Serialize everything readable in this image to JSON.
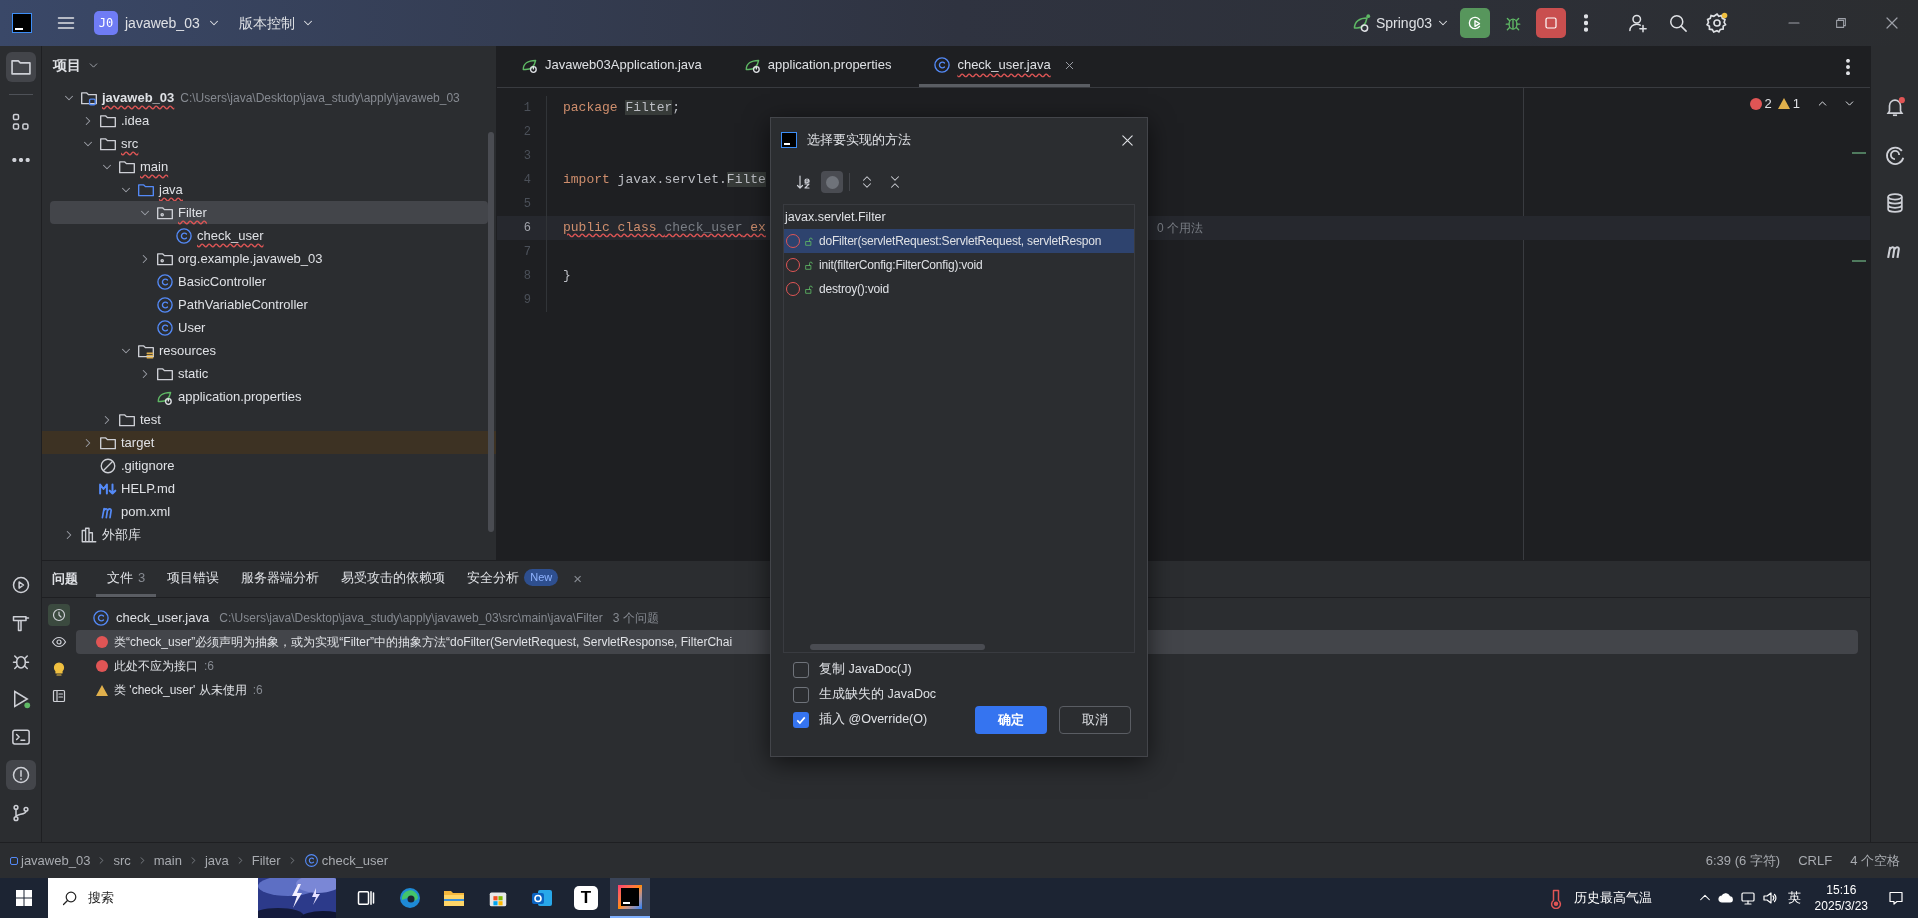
{
  "title_bar": {
    "project_badge": "J0",
    "project": "javaweb_03",
    "vcs": "版本控制",
    "run_config": "Spring03"
  },
  "left_toolbar": {
    "top": [
      {
        "kind": "project",
        "selected": true
      },
      {
        "kind": "structure",
        "selected": false
      },
      {
        "kind": "more",
        "selected": false
      }
    ],
    "bottom": [
      {
        "kind": "services",
        "selected": false
      },
      {
        "kind": "build",
        "selected": false
      },
      {
        "kind": "debug",
        "selected": false
      },
      {
        "kind": "run",
        "selected": false
      },
      {
        "kind": "terminal",
        "selected": false
      },
      {
        "kind": "problems",
        "selected": true
      },
      {
        "kind": "git",
        "selected": false
      }
    ]
  },
  "right_toolbar": [
    {
      "kind": "notifications",
      "badge": true
    },
    {
      "kind": "ai",
      "badge": false
    },
    {
      "kind": "database",
      "badge": false
    },
    {
      "kind": "maven",
      "badge": false
    }
  ],
  "project_panel": {
    "title": "项目",
    "tree": [
      {
        "label": "javaweb_03",
        "kind": "module",
        "hint": "C:\\Users\\java\\Desktop\\java_study\\apply\\javaweb_03",
        "expanded": true,
        "selected": false,
        "excluded": false,
        "has_error": true,
        "children": [
          {
            "label": ".idea",
            "kind": "folder",
            "expanded": false,
            "selected": false,
            "excluded": false,
            "has_error": false
          },
          {
            "label": "src",
            "kind": "folder",
            "expanded": true,
            "selected": false,
            "excluded": false,
            "has_error": true,
            "children": [
              {
                "label": "main",
                "kind": "folder",
                "expanded": true,
                "selected": false,
                "excluded": false,
                "has_error": true,
                "children": [
                  {
                    "label": "java",
                    "kind": "source",
                    "expanded": true,
                    "selected": false,
                    "excluded": false,
                    "has_error": true,
                    "children": [
                      {
                        "label": "Filter",
                        "kind": "package",
                        "expanded": true,
                        "selected": true,
                        "excluded": false,
                        "has_error": true,
                        "children": [
                          {
                            "label": "check_user",
                            "kind": "class",
                            "selected": false,
                            "excluded": false,
                            "has_error": true
                          }
                        ]
                      },
                      {
                        "label": "org.example.javaweb_03",
                        "kind": "package",
                        "expanded": false,
                        "selected": false,
                        "excluded": false,
                        "has_error": false
                      },
                      {
                        "label": "BasicController",
                        "kind": "class",
                        "selected": false,
                        "excluded": false,
                        "has_error": false
                      },
                      {
                        "label": "PathVariableController",
                        "kind": "class",
                        "selected": false,
                        "excluded": false,
                        "has_error": false
                      },
                      {
                        "label": "User",
                        "kind": "class",
                        "selected": false,
                        "excluded": false,
                        "has_error": false
                      }
                    ]
                  },
                  {
                    "label": "resources",
                    "kind": "resources",
                    "expanded": true,
                    "selected": false,
                    "excluded": false,
                    "has_error": false,
                    "children": [
                      {
                        "label": "static",
                        "kind": "folder",
                        "expanded": false,
                        "selected": false,
                        "excluded": false,
                        "has_error": false
                      },
                      {
                        "label": "application.properties",
                        "kind": "spring",
                        "selected": false,
                        "excluded": false,
                        "has_error": false
                      }
                    ]
                  }
                ]
              },
              {
                "label": "test",
                "kind": "folder",
                "expanded": false,
                "selected": false,
                "excluded": false,
                "has_error": false
              }
            ]
          },
          {
            "label": "target",
            "kind": "folder",
            "expanded": false,
            "selected": false,
            "excluded": true,
            "has_error": false
          },
          {
            "label": ".gitignore",
            "kind": "ignore",
            "selected": false,
            "excluded": false,
            "has_error": false
          },
          {
            "label": "HELP.md",
            "kind": "markdown",
            "selected": false,
            "excluded": false,
            "has_error": false
          },
          {
            "label": "pom.xml",
            "kind": "maven",
            "selected": false,
            "excluded": false,
            "has_error": false
          }
        ]
      },
      {
        "label": "外部库",
        "kind": "library",
        "expanded": false,
        "selected": false,
        "excluded": false,
        "has_error": false
      }
    ]
  },
  "editor": {
    "tabs": [
      {
        "label": "Javaweb03Application.java",
        "kind": "spring",
        "selected": false,
        "has_error": false
      },
      {
        "label": "application.properties",
        "kind": "spring",
        "selected": false,
        "has_error": false
      },
      {
        "label": "check_user.java",
        "kind": "class",
        "selected": true,
        "has_error": true
      }
    ],
    "errors": "2",
    "warnings": "1",
    "lines": [
      {
        "number": "1",
        "current": false,
        "tokens": [
          {
            "text": "package ",
            "kind": "keyword"
          },
          {
            "text": "Filter",
            "kind": "highlight"
          },
          {
            "text": ";",
            "kind": "plain"
          }
        ]
      },
      {
        "number": "2",
        "current": false
      },
      {
        "number": "3",
        "current": false
      },
      {
        "number": "4",
        "current": false,
        "tokens": [
          {
            "text": "import ",
            "kind": "keyword"
          },
          {
            "text": "javax.servlet.",
            "kind": "plain"
          },
          {
            "text": "Filte",
            "kind": "highlight"
          }
        ]
      },
      {
        "number": "5",
        "current": false
      },
      {
        "number": "6",
        "current": true,
        "inlay": "0 个用法",
        "tokens": [
          {
            "text": "public class ",
            "kind": "keyword_error"
          },
          {
            "text": "check_user",
            "kind": "unused_error"
          },
          {
            "text": " ex",
            "kind": "keyword_error"
          }
        ]
      },
      {
        "number": "7",
        "current": false
      },
      {
        "number": "8",
        "current": false,
        "tokens": [
          {
            "text": "}",
            "kind": "plain"
          }
        ]
      },
      {
        "number": "9",
        "current": false
      }
    ]
  },
  "problems_panel": {
    "title": "问题",
    "tabs": [
      {
        "label": "文件",
        "count": "3",
        "selected": true
      },
      {
        "label": "项目错误",
        "selected": false
      },
      {
        "label": "服务器端分析",
        "selected": false
      },
      {
        "label": "易受攻击的依赖项",
        "selected": false
      },
      {
        "label": "安全分析",
        "badge": "New",
        "selected": false
      }
    ],
    "close": "×",
    "toolbar": [
      {
        "kind": "autoscroll",
        "selected": true
      },
      {
        "kind": "preview",
        "selected": false
      },
      {
        "kind": "quickfix",
        "selected": false
      },
      {
        "kind": "details",
        "selected": false
      }
    ],
    "file": {
      "name": "check_user.java",
      "path": "C:\\Users\\java\\Desktop\\java_study\\apply\\javaweb_03\\src\\main\\java\\Filter",
      "count": "3 个问题"
    },
    "items": [
      {
        "kind": "error",
        "text": "类“check_user”必须声明为抽象，或为实现“Filter”中的抽象方法“doFilter(ServletRequest, ServletResponse, FilterChai",
        "selected": true
      },
      {
        "kind": "error",
        "text": "此处不应为接口",
        "line": ":6",
        "selected": false
      },
      {
        "kind": "warning",
        "text": "类 'check_user' 从未使用",
        "line": ":6",
        "selected": false
      }
    ]
  },
  "dialog": {
    "title": "选择要实现的方法",
    "toolbar": [
      {
        "kind": "sort",
        "selected": false
      },
      {
        "kind": "toggle",
        "selected": true
      },
      {
        "kind": "expand",
        "selected": false
      },
      {
        "kind": "collapse",
        "selected": false
      }
    ],
    "group": "javax.servlet.Filter",
    "methods": [
      {
        "label": "doFilter(servletRequest:ServletRequest, servletRespon",
        "selected": true
      },
      {
        "label": "init(filterConfig:FilterConfig):void",
        "selected": false
      },
      {
        "label": "destroy():void",
        "selected": false
      }
    ],
    "options": [
      {
        "label": "复制 JavaDoc(J)",
        "checked": false
      },
      {
        "label": "生成缺失的 JavaDoc",
        "checked": false
      },
      {
        "label": "插入 @Override(O)",
        "checked": true
      }
    ],
    "ok": "确定",
    "cancel": "取消"
  },
  "status_bar": {
    "breadcrumbs": [
      {
        "label": "javaweb_03",
        "kind": "module"
      },
      {
        "label": "src",
        "kind": "none"
      },
      {
        "label": "main",
        "kind": "none"
      },
      {
        "label": "java",
        "kind": "none"
      },
      {
        "label": "Filter",
        "kind": "none"
      },
      {
        "label": "check_user",
        "kind": "class"
      }
    ],
    "position": "6:39 (6 字符)",
    "line_ending": "CRLF",
    "indent": "4 个空格"
  },
  "taskbar": {
    "search": "搜索",
    "apps": [
      {
        "kind": "taskview",
        "active": false
      },
      {
        "kind": "edge",
        "active": false
      },
      {
        "kind": "explorer",
        "active": false
      },
      {
        "kind": "store",
        "active": false
      },
      {
        "kind": "outlook",
        "active": false
      },
      {
        "kind": "typora",
        "label": "T",
        "active": false
      },
      {
        "kind": "intellij",
        "active": true
      }
    ],
    "weather": "历史最高气温",
    "input_method": "英",
    "time": "15:16",
    "date": "2025/3/23"
  }
}
